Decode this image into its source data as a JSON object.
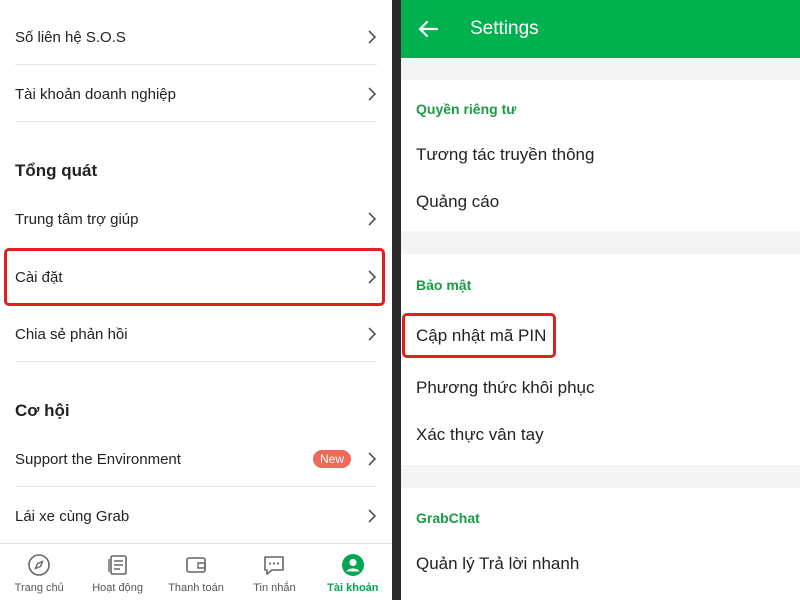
{
  "left": {
    "rows_top": [
      {
        "label": "Số liên hệ S.O.S"
      },
      {
        "label": "Tài khoản doanh nghiệp"
      }
    ],
    "section_general": "Tổng quát",
    "rows_general": [
      {
        "label": "Trung tâm trợ giúp"
      },
      {
        "label": "Cài đặt"
      },
      {
        "label": "Chia sẻ phản hồi"
      }
    ],
    "section_opportunity": "Cơ hội",
    "rows_opportunity": [
      {
        "label": "Support the Environment",
        "badge": "New"
      },
      {
        "label": "Lái xe cùng Grab"
      }
    ],
    "bottom_nav": [
      {
        "label": "Trang chủ",
        "icon": "compass-icon"
      },
      {
        "label": "Hoạt động",
        "icon": "document-icon"
      },
      {
        "label": "Thanh toán",
        "icon": "wallet-icon"
      },
      {
        "label": "Tin nhắn",
        "icon": "chat-icon"
      },
      {
        "label": "Tài khoản",
        "icon": "account-icon",
        "active": true
      }
    ]
  },
  "right": {
    "title": "Settings",
    "privacy": {
      "heading": "Quyền riêng tư",
      "items": [
        "Tương tác truyền thông",
        "Quảng cáo"
      ]
    },
    "security": {
      "heading": "Bảo mật",
      "items": [
        "Cập nhật mã PIN",
        "Phương thức khôi phục",
        "Xác thực vân tay"
      ]
    },
    "grabchat": {
      "heading": "GrabChat",
      "items": [
        "Quản lý Trả lời nhanh"
      ]
    }
  },
  "colors": {
    "brand_green": "#00b14f",
    "heading_green": "#1a9b44",
    "highlight_red": "#e02020",
    "badge_red": "#ee6b5a"
  }
}
